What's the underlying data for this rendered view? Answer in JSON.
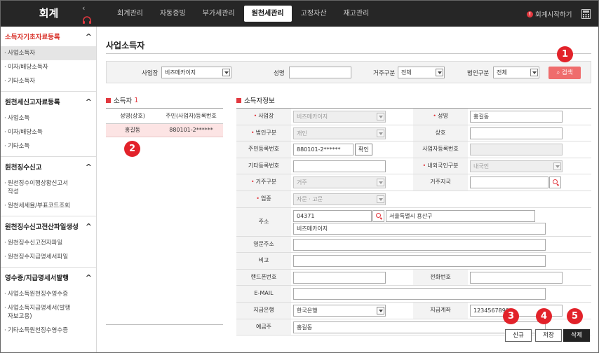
{
  "app": {
    "title": "회계"
  },
  "topnav": [
    {
      "label": "회계관리",
      "active": false
    },
    {
      "label": "자동증빙",
      "active": false
    },
    {
      "label": "부가세관리",
      "active": false
    },
    {
      "label": "원천세관리",
      "active": true
    },
    {
      "label": "고정자산",
      "active": false
    },
    {
      "label": "재고관리",
      "active": false
    }
  ],
  "header": {
    "start_label": "회계시작하기",
    "info_mark": "!"
  },
  "sidebar": {
    "sections": [
      {
        "title": "소득자기초자료등록",
        "current": true,
        "items": [
          "사업소득자",
          "이자/배당소득자",
          "기타소득자"
        ]
      },
      {
        "title": "원천세신고자료등록",
        "current": false,
        "items": [
          "사업소득",
          "이자/배당소득",
          "기타소득"
        ]
      },
      {
        "title": "원천징수신고",
        "current": false,
        "items": [
          "원천징수이행상황신고서작성",
          "원천세세율/부표코드조회"
        ]
      },
      {
        "title": "원천징수신고전산파일생성",
        "current": false,
        "items": [
          "원천징수신고전자파일",
          "원천징수지급명세서파일"
        ]
      },
      {
        "title": "영수증/지급명세서발행",
        "current": false,
        "items": [
          "사업소득원천징수영수증",
          "사업소득지급명세서(발행자보고용)",
          "기타소득원천징수영수증"
        ]
      }
    ],
    "selected_item": "사업소득자"
  },
  "page": {
    "title": "사업소득자"
  },
  "search": {
    "workplace_label": "사업장",
    "workplace_value": "비즈메카이지",
    "name_label": "성명",
    "name_value": "",
    "residence_label": "거주구분",
    "residence_value": "전체",
    "corp_label": "법인구분",
    "corp_value": "전체",
    "search_button": "검색"
  },
  "list": {
    "title": "소득자",
    "count": "1",
    "col_name": "성명(상호)",
    "col_id": "주민(사업자)등록번호",
    "rows": [
      {
        "name": "홍길동",
        "id": "880101-2******"
      }
    ]
  },
  "detail": {
    "title": "소득자정보",
    "workplace_label": "사업장",
    "workplace_value": "비즈메카이지",
    "name_label": "성명",
    "name_value": "홍길동",
    "corp_label": "법인구분",
    "corp_value": "개인",
    "company_label": "상호",
    "company_value": "",
    "rrn_label": "주민등록번호",
    "rrn_value": "880101-2******",
    "confirm_button": "확인",
    "bizno_label": "사업자등록번호",
    "bizno_value": "",
    "etcno_label": "기타등록번호",
    "etcno_value": "",
    "foreign_label": "내외국인구분",
    "foreign_value": "내국인",
    "residence_label": "거주구분",
    "residence_value": "거주",
    "country_label": "거주지국",
    "country_value": "",
    "industry_label": "업종",
    "industry_value": "자문 · 고문",
    "address_label": "주소",
    "zip_value": "04371",
    "address1_value": "서울특별시 용산구",
    "address2_value": "비즈메카이지",
    "eng_address_label": "영문주소",
    "eng_address_value": "",
    "note_label": "비고",
    "note_value": "",
    "mobile_label": "핸드폰번호",
    "mobile_value": "",
    "phone_label": "전화번호",
    "phone_value": "",
    "email_label": "E-MAIL",
    "email_value": "",
    "bank_label": "지급은행",
    "bank_value": "한국은행",
    "account_label": "지급계좌",
    "account_value": "1234567890",
    "holder_label": "예금주",
    "holder_value": "홍길동"
  },
  "actions": {
    "new_label": "신규",
    "save_label": "저장",
    "delete_label": "삭제"
  },
  "badges": [
    "1",
    "2",
    "3",
    "4",
    "5"
  ],
  "colors": {
    "accent": "#e2383f",
    "topbar": "#262626",
    "search_button": "#ef6c6c",
    "badge": "#e2222a"
  }
}
